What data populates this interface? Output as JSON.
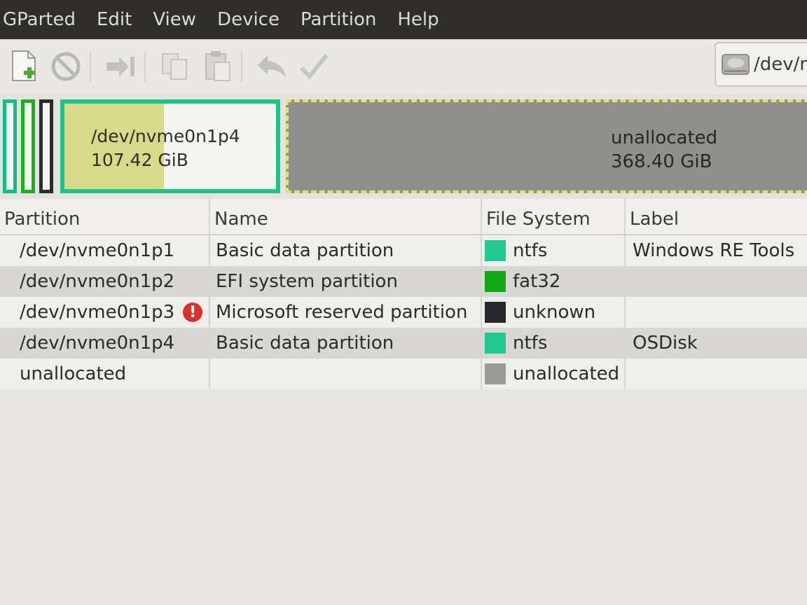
{
  "menubar": {
    "items": [
      "GParted",
      "Edit",
      "View",
      "Device",
      "Partition",
      "Help"
    ]
  },
  "toolbar": {
    "buttons": [
      "new-partition-icon",
      "delete-icon",
      "resize-move-icon",
      "copy-icon",
      "paste-icon",
      "undo-icon",
      "apply-icon"
    ],
    "device_label": "/dev/n"
  },
  "partition_map": {
    "selected": {
      "name": "/dev/nvme0n1p4",
      "size": "107.42 GiB"
    },
    "unallocated": {
      "name": "unallocated",
      "size": "368.40 GiB"
    }
  },
  "table": {
    "headers": [
      "Partition",
      "Name",
      "File System",
      "Label"
    ],
    "rows": [
      {
        "partition": "/dev/nvme0n1p1",
        "name": "Basic data partition",
        "fs": "ntfs",
        "fs_color": "#1fc98f",
        "label": "Windows RE Tools",
        "warning": false
      },
      {
        "partition": "/dev/nvme0n1p2",
        "name": "EFI system partition",
        "fs": "fat32",
        "fs_color": "#10a814",
        "label": "",
        "warning": false
      },
      {
        "partition": "/dev/nvme0n1p3",
        "name": "Microsoft reserved partition",
        "fs": "unknown",
        "fs_color": "#24282a",
        "label": "",
        "warning": true,
        "warning_glyph": "!"
      },
      {
        "partition": "/dev/nvme0n1p4",
        "name": "Basic data partition",
        "fs": "ntfs",
        "fs_color": "#1fc98f",
        "label": "OSDisk",
        "warning": false
      },
      {
        "partition": "unallocated",
        "name": "",
        "fs": "unallocated",
        "fs_color": "#9a9a96",
        "label": "",
        "warning": false
      }
    ]
  }
}
